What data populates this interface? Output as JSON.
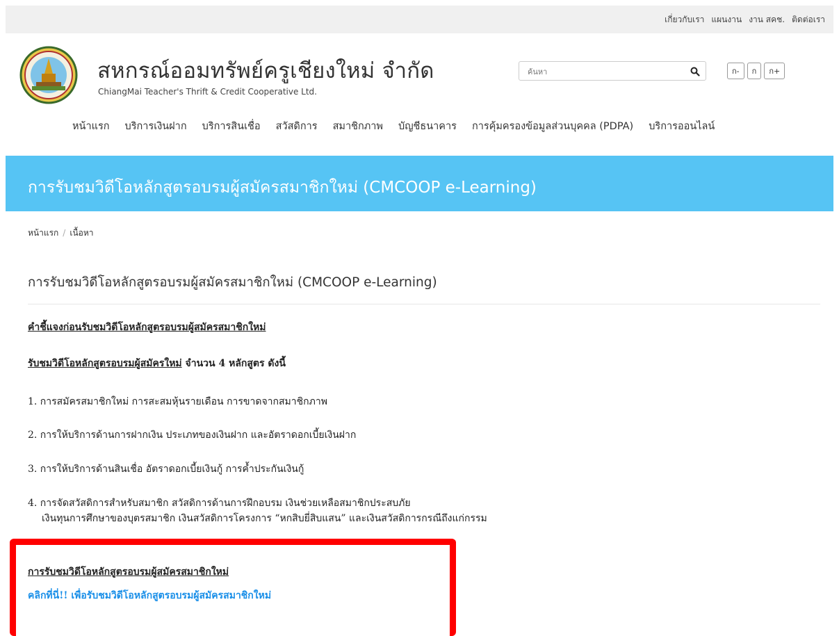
{
  "top_links": [
    "เกี่ยวกับเรา",
    "แผนงาน",
    "งาน สคช.",
    "ติดต่อเรา"
  ],
  "site": {
    "title": "สหกรณ์ออมทรัพย์ครูเชียงใหม่ จำกัด",
    "subtitle": "ChiangMai Teacher's Thrift & Credit Cooperative Ltd."
  },
  "search": {
    "placeholder": "ค้นหา"
  },
  "font_size_buttons": [
    "ก-",
    "ก",
    "ก+"
  ],
  "nav": [
    "หน้าแรก",
    "บริการเงินฝาก",
    "บริการสินเชื่อ",
    "สวัสดิการ",
    "สมาชิกภาพ",
    "บัญชีธนาคาร",
    "การคุ้มครองข้อมูลส่วนบุคคล (PDPA)",
    "บริการออนไลน์"
  ],
  "banner_title": "การรับชมวิดีโอหลักสูตรอบรมผู้สมัครสมาชิกใหม่ (CMCOOP e-Learning)",
  "breadcrumb": [
    "หน้าแรก",
    "เนื้อหา"
  ],
  "content": {
    "title": "การรับชมวิดีโอหลักสูตรอบรมผู้สมัครสมาชิกใหม่ (CMCOOP e-Learning)",
    "instructions_heading": "คำชี้แจงก่อนรับชมวิดีโอหลักสูตรอบรมผู้สมัครสมาชิกใหม่",
    "courses_intro_underlined": "รับชมวิดีโอหลักสูตรอบรมผู้สมัครใหม่",
    "courses_intro_rest": " จำนวน 4 หลักสูตร ดังนี้",
    "items": [
      "1.  การสมัครสมาชิกใหม่ การสะสมหุ้นรายเดือน การขาดจากสมาชิกภาพ",
      "2.  การให้บริการด้านการฝากเงิน ประเภทของเงินฝาก และอัตราดอกเบี้ยเงินฝาก",
      "3.  การให้บริการด้านสินเชื่อ อัตราดอกเบี้ยเงินกู้ การค้ำประกันเงินกู้",
      "4.  การจัดสวัสดิการสำหรับสมาชิก สวัสดิการด้านการฝึกอบรม เงินช่วยเหลือสมาชิกประสบภัย"
    ],
    "item4_line2": "เงินทุนการศึกษาของบุตรสมาชิก เงินสวัสดิการโครงการ “หกสิบยี่สิบแสน” และเงินสวัสดิการกรณีถึงแก่กรรม",
    "video_heading": "การรับชมวิดีโอหลักสูตรอบรมผู้สมัครสมาชิกใหม่",
    "video_link": "คลิกที่นี่!! เพื่อรับชมวิดีโอหลักสูตรอบรมผู้สมัครสมาชิกใหม่"
  },
  "colors": {
    "banner": "#56c4f4",
    "link": "#1a8fe8",
    "highlight_border": "#ff0000"
  },
  "icons": {
    "search": "search-icon",
    "logo": "cooperative-logo"
  }
}
